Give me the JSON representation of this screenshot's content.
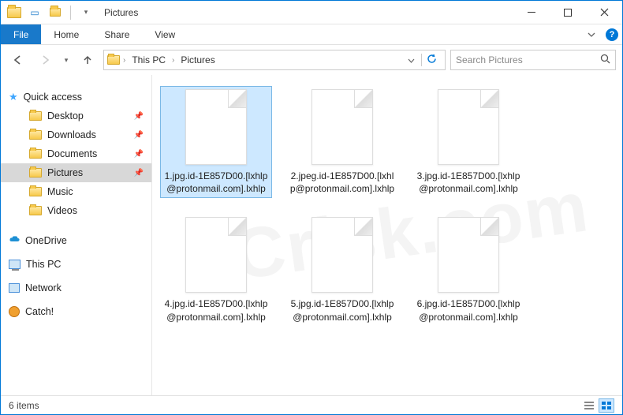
{
  "title": "Pictures",
  "ribbon": {
    "file": "File",
    "tabs": [
      "Home",
      "Share",
      "View"
    ]
  },
  "breadcrumb": [
    "This PC",
    "Pictures"
  ],
  "search_placeholder": "Search Pictures",
  "sidebar": {
    "quick_access": "Quick access",
    "items": [
      {
        "label": "Desktop",
        "pinned": true
      },
      {
        "label": "Downloads",
        "pinned": true
      },
      {
        "label": "Documents",
        "pinned": true
      },
      {
        "label": "Pictures",
        "pinned": true,
        "selected": true
      },
      {
        "label": "Music",
        "pinned": false
      },
      {
        "label": "Videos",
        "pinned": false
      }
    ],
    "onedrive": "OneDrive",
    "this_pc": "This PC",
    "network": "Network",
    "catch": "Catch!"
  },
  "files": [
    {
      "name": "1.jpg.id-1E857D00.[lxhlp@protonmail.com].lxhlp",
      "selected": true
    },
    {
      "name": "2.jpeg.id-1E857D00.[lxhlp@protonmail.com].lxhlp",
      "selected": false
    },
    {
      "name": "3.jpg.id-1E857D00.[lxhlp@protonmail.com].lxhlp",
      "selected": false
    },
    {
      "name": "4.jpg.id-1E857D00.[lxhlp@protonmail.com].lxhlp",
      "selected": false
    },
    {
      "name": "5.jpg.id-1E857D00.[lxhlp@protonmail.com].lxhlp",
      "selected": false
    },
    {
      "name": "6.jpg.id-1E857D00.[lxhlp@protonmail.com].lxhlp",
      "selected": false
    }
  ],
  "status": "6 items",
  "watermark": "PCrisk.com"
}
